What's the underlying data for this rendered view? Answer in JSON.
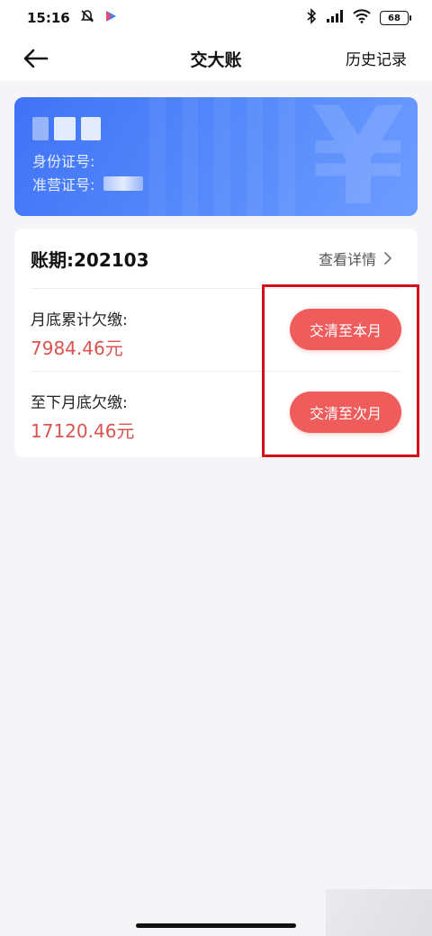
{
  "status_bar": {
    "time": "15:16",
    "battery": "68",
    "icons": [
      "mute-icon",
      "play-store-icon",
      "bluetooth-icon",
      "signal-icon",
      "wifi-icon",
      "battery-icon"
    ]
  },
  "nav": {
    "title": "交大账",
    "history_label": "历史记录",
    "back_icon": "arrow-left-icon"
  },
  "id_card": {
    "id_number_label": "身份证号:",
    "license_label": "准营证号:",
    "background_icon": "¥",
    "colors": {
      "start": "#3f73f6",
      "end": "#6d9cff"
    }
  },
  "bill": {
    "period_label": "账期:202103",
    "detail_label": "查看详情",
    "rows": [
      {
        "label": "月底累计欠缴:",
        "amount": "7984.46元",
        "button_label": "交清至本月"
      },
      {
        "label": "至下月底欠缴:",
        "amount": "17120.46元",
        "button_label": "交清至次月"
      }
    ],
    "colors": {
      "amount": "#d9534f",
      "button": "#ee5c5c",
      "highlight": "#d40f1c"
    }
  }
}
